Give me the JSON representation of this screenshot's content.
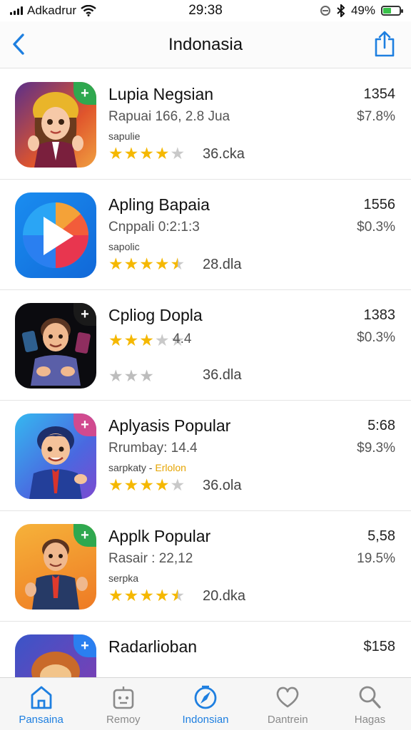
{
  "status_bar": {
    "carrier": "Adkadrur",
    "time": "29:38",
    "battery_percent": "49%",
    "icons": [
      "signal-icon",
      "wifi-icon",
      "location-icon",
      "bluetooth-icon",
      "battery-icon"
    ],
    "battery_level": 0.49,
    "battery_color": "#39c24a"
  },
  "nav": {
    "title": "Indonasia",
    "back_icon": "chevron-left-icon",
    "share_icon": "share-icon",
    "accent_color": "#1e7fe0"
  },
  "apps": [
    {
      "name": "Lupia Negsian",
      "subtitle": "Rapuai 166, 2.8 Jua",
      "category": "sapulie",
      "category_extra": "",
      "rating": 4,
      "rating_count": "36.cka",
      "price": "1354",
      "change": "$7.8%",
      "icon_art": "girl-avatar",
      "badge": "+"
    },
    {
      "name": "Apling Bapaia",
      "subtitle": "Cnppali 0:2:1:3",
      "category": "sapolic",
      "category_extra": "",
      "rating": 4.5,
      "rating_count": "28.dla",
      "price": "1556",
      "change": "$0.3%",
      "icon_art": "play-logo",
      "badge": ""
    },
    {
      "name": "Cpliog Dopla",
      "subtitle": "4.4",
      "category": "",
      "category_extra": "",
      "rating": 3,
      "rating_count": "36.dla",
      "price": "1383",
      "change": "$0.3%",
      "icon_art": "man-avatar-dark",
      "badge": "+"
    },
    {
      "name": "Aplyasis Popular",
      "subtitle": "Rrumbay: 14.4",
      "category": "sarpkaty -",
      "category_extra": "Erlolon",
      "rating": 4,
      "rating_count": "36.ola",
      "price": "5:68",
      "change": "$9.3%",
      "icon_art": "boy-avatar",
      "badge": "+"
    },
    {
      "name": "Applk Popular",
      "subtitle": "Rasair : 22,12",
      "category": "serpka",
      "category_extra": "",
      "rating": 4.5,
      "rating_count": "20.dka",
      "price": "5,58",
      "change": "19.5%",
      "icon_art": "businessman-avatar",
      "badge": "+"
    },
    {
      "name": "Radarlioban",
      "subtitle": "",
      "category": "",
      "category_extra": "",
      "rating": 0,
      "rating_count": "",
      "price": "$158",
      "change": "",
      "icon_art": "helmet-avatar",
      "badge": "+"
    }
  ],
  "tabs": [
    {
      "label": "Pansaina",
      "icon": "home-icon",
      "active": true
    },
    {
      "label": "Remoy",
      "icon": "robot-icon",
      "active": false
    },
    {
      "label": "Indonsian",
      "icon": "compass-icon",
      "active": true
    },
    {
      "label": "Dantrein",
      "icon": "heart-icon",
      "active": false
    },
    {
      "label": "Hagas",
      "icon": "search-icon",
      "active": false
    }
  ]
}
